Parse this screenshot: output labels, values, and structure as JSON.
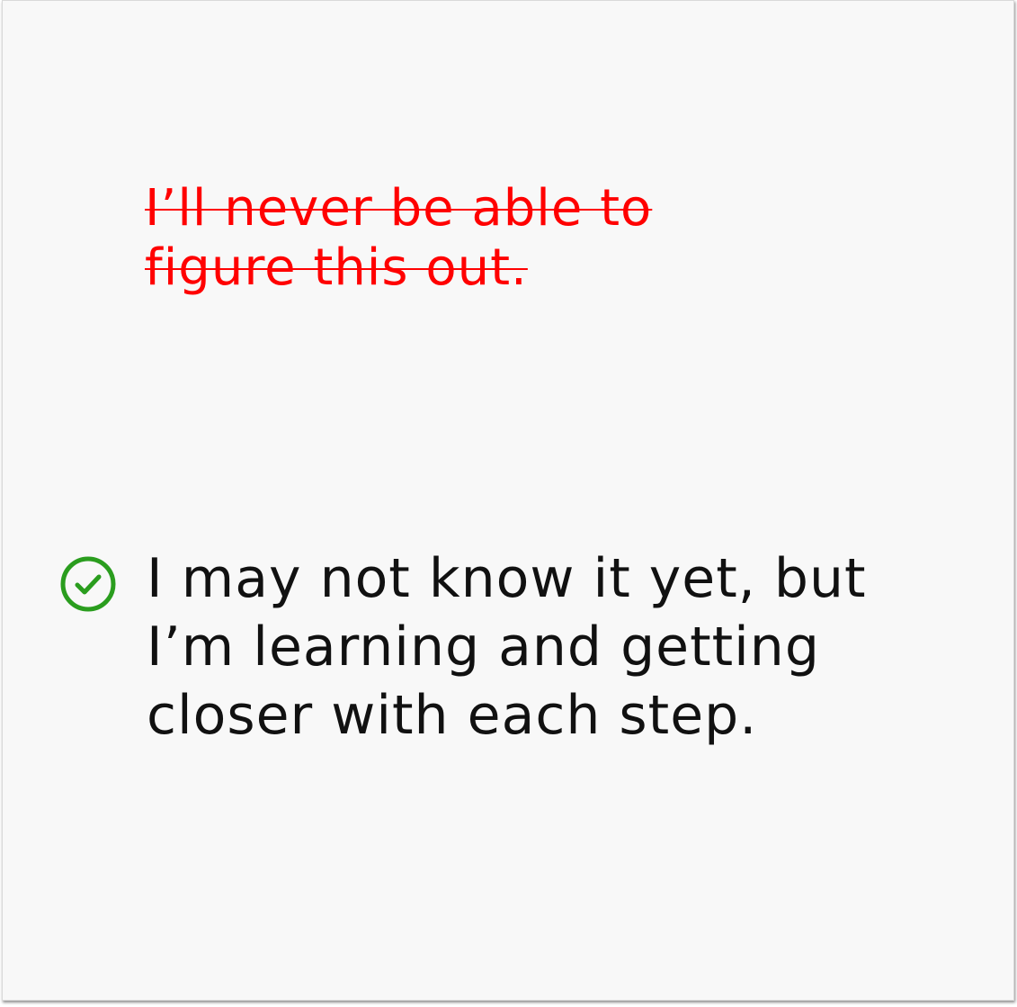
{
  "crossed_out_thought": "I’ll never be able to figure this out.",
  "affirmation": "I may not know it yet, but I’m learning and getting closer with each step.",
  "colors": {
    "crossed_out": "#ff0000",
    "check": "#2a9d1e",
    "text": "#111111",
    "background": "#f8f8f8"
  },
  "icons": {
    "check": "check-circle-icon"
  }
}
